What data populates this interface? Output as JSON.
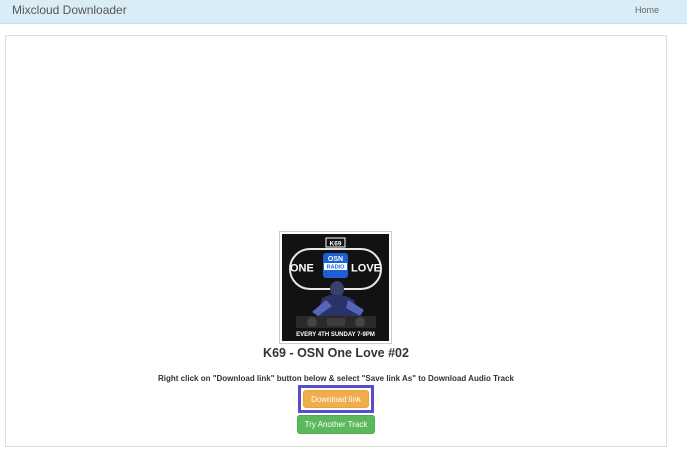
{
  "navbar": {
    "brand": "Mixcloud Downloader",
    "home_link": "Home"
  },
  "cover": {
    "badge": "K69",
    "word_left": "ONE",
    "word_right": "LOVE",
    "logo_top": "OSN",
    "logo_bottom": "RADIO",
    "footer": "EVERY 4TH SUNDAY 7-9PM"
  },
  "track": {
    "title": "K69 - OSN One Love #02"
  },
  "instruction": "Right click on \"Download link\" button below & select \"Save link As\" to Download Audio Track",
  "buttons": {
    "download_label": "Download link",
    "try_label": "Try Another Track"
  },
  "colors": {
    "navbar_bg": "#d9edf7",
    "download_button": "#f0ad4e",
    "try_button": "#5cb85c",
    "highlight_border": "#5b4ccf"
  }
}
